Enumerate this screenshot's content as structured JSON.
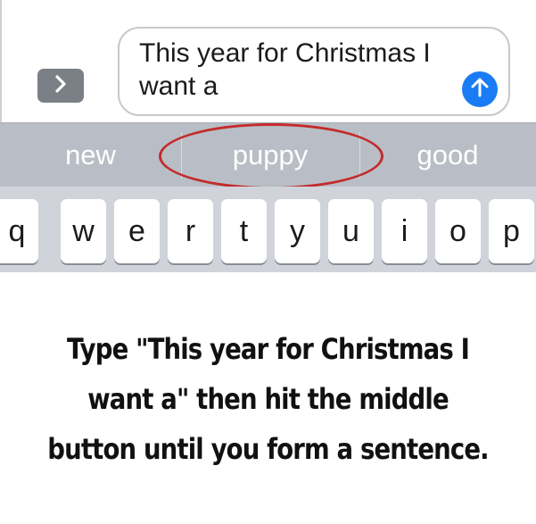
{
  "composer": {
    "expand_icon": "chevron-right-icon",
    "message_text": "This year for Christmas I want a",
    "send_icon": "arrow-up-icon",
    "colors": {
      "send": "#1a7cf5",
      "expand": "#7b7f86"
    }
  },
  "predictions": {
    "left": "new",
    "middle": "puppy",
    "right": "good",
    "highlight_color": "#c42b2b"
  },
  "keyboard": {
    "keys": [
      "q",
      "w",
      "e",
      "r",
      "t",
      "y",
      "u",
      "i",
      "o",
      "p"
    ]
  },
  "caption": {
    "text": "Type \"This year for Christmas I want a\" then hit the middle button until you form a sentence."
  }
}
